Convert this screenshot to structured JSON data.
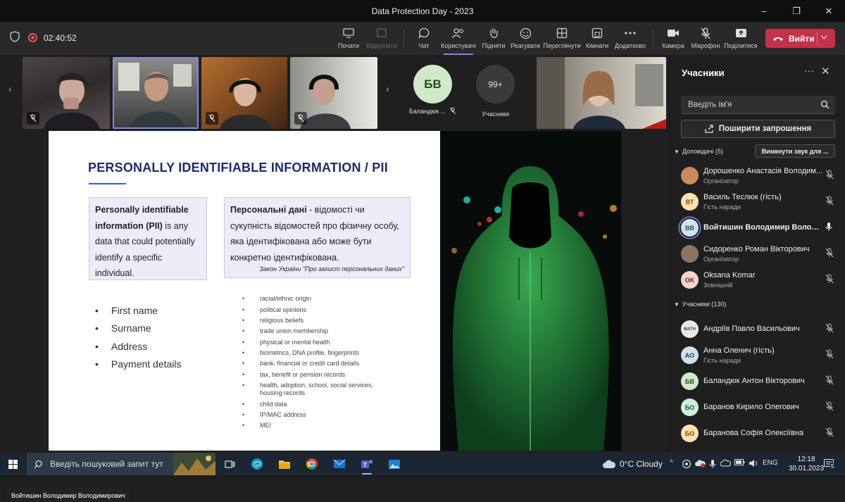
{
  "window": {
    "title": "Data Protection Day - 2023",
    "min": "–",
    "max": "❐",
    "close": "✕"
  },
  "toolbar": {
    "timer": "02:40:52",
    "buttons": [
      {
        "label": "Почати",
        "icon": "share-screen-icon"
      },
      {
        "label": "Відкріпити",
        "icon": "unpin-icon"
      },
      {
        "label": "Чат",
        "icon": "chat-icon"
      },
      {
        "label": "Користувачі",
        "icon": "people-icon"
      },
      {
        "label": "Підняти",
        "icon": "raise-hand-icon"
      },
      {
        "label": "Реагувати",
        "icon": "react-icon"
      },
      {
        "label": "Переглянути",
        "icon": "view-icon"
      },
      {
        "label": "Кімнати",
        "icon": "rooms-icon"
      },
      {
        "label": "Додатково",
        "icon": "more-icon"
      },
      {
        "label": "Камера",
        "icon": "camera-icon"
      },
      {
        "label": "Мікрофон",
        "icon": "mic-off-icon"
      },
      {
        "label": "Поділитися",
        "icon": "share-icon"
      }
    ],
    "leave_label": "Вийти"
  },
  "stage": {
    "avatar_initials": "БВ",
    "avatar_name": "Баландюк ...",
    "more_count": "99+",
    "more_label": "Учасники",
    "nametag": "Войтишин Володимир Володимирович"
  },
  "slide": {
    "title": "PERSONALLY IDENTIFIABLE INFORMATION / PII",
    "box_left_bold": "Personally identifiable information (PII)",
    "box_left_text": " is any data that could potentially identify a specific individual.",
    "box_right_bold": "Персональні дані",
    "box_right_text": " - відомості чи сукупність відомостей про фізичну особу, яка ідентифікована або може бути конкретно ідентифікована.",
    "box_right_law": "Закон України \"Про захист персональних даних\"",
    "list_left": [
      "First name",
      "Surname",
      "Address",
      "Payment details"
    ],
    "list_right": [
      "racial/ethnic origin",
      "political opinions",
      "religious beliefs",
      "trade union membership",
      "physical or mental health",
      "biometrics, DNA profile, fingerprints",
      "bank, financial or credit card details",
      "tax, benefit or pension records",
      "health, adoption, school, social services, housing records",
      "child data",
      "IP/MAC address",
      "MEI"
    ]
  },
  "panel": {
    "title": "Учасники",
    "more": "···",
    "close": "✕",
    "search_placeholder": "Введіть ім'я",
    "invite_label": "Поширити запрошення",
    "presenters_label": "Доповідачі (5)",
    "mute_all_label": "Вимкнути звук для ...",
    "attendees_label": "Учасники (130)",
    "presenters": [
      {
        "initials": "",
        "name": "Дорошенко Анастасія Володим...",
        "role": "Організатор",
        "color": "#c98d5a",
        "fg": "#fff"
      },
      {
        "initials": "ВТ",
        "name": "Василь Теслюк (гість)",
        "role": "Гість наради",
        "color": "#fce2b3",
        "fg": "#7a4a00"
      },
      {
        "initials": "ВВ",
        "name": "Войтишин Володимир Володи...",
        "role": "",
        "color": "#cfe4ea",
        "fg": "#1c5566"
      },
      {
        "initials": "",
        "name": "Сидоренко Роман Вікторович",
        "role": "Організатор",
        "color": "#8a7563",
        "fg": "#fff"
      },
      {
        "initials": "OK",
        "name": "Oksana Komar",
        "role": "Зовнішній",
        "color": "#f1d6cf",
        "fg": "#6b2b1e"
      }
    ],
    "attendees": [
      {
        "initials": "MATH",
        "name": "Андріїв Павло Васильович",
        "role": "",
        "color": "#e8e8e8",
        "fg": "#444"
      },
      {
        "initials": "АО",
        "name": "Анна Оленич (гість)",
        "role": "Гість наради",
        "color": "#cfe0ef",
        "fg": "#1c4566"
      },
      {
        "initials": "БВ",
        "name": "Баландюк Антон Вікторович",
        "role": "",
        "color": "#d1e8c9",
        "fg": "#264d1d"
      },
      {
        "initials": "БО",
        "name": "Баранов Кирило Олегович",
        "role": "",
        "color": "#cfeedd",
        "fg": "#1d5a3a"
      },
      {
        "initials": "БО",
        "name": "Баранова Софія Олексіївна",
        "role": "",
        "color": "#fce2b3",
        "fg": "#7a4a00"
      }
    ]
  },
  "taskbar": {
    "search_placeholder": "Введіть пошуковий запит тут",
    "weather": "0°C  Cloudy",
    "lang": "ENG",
    "time": "12:18",
    "date": "30.01.2023",
    "notif_count": "5"
  },
  "colors": {
    "accent": "#7f85f5",
    "leave": "#c4314b",
    "slide_title": "#1e2b6f"
  }
}
